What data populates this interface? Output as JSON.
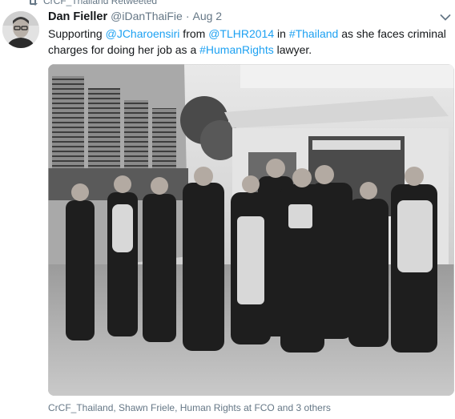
{
  "retweet_context": {
    "label": "CrCF_Thailand Retweeted",
    "icon": "retweet-icon"
  },
  "tweet": {
    "author_name": "Dan Fieller",
    "author_handle": "@iDanThaiFie",
    "separator": "·",
    "date": "Aug 2",
    "text_parts": [
      "Supporting ",
      "@JCharoensiri",
      " from ",
      "@TLHR2014",
      " in ",
      "#Thailand",
      " as she faces criminal charges for doing her job as a ",
      "#HumanRights",
      " lawyer."
    ],
    "photo_tags": "CrCF_Thailand, Shawn Friele, Human Rights at FCO and 3 others"
  },
  "icons": {
    "avatar": "avatar-photo",
    "menu": "chevron-down-icon",
    "photo": "group-photo"
  },
  "colors": {
    "link": "#1da1f2",
    "secondary_text": "#657786",
    "primary_text": "#14171a"
  }
}
